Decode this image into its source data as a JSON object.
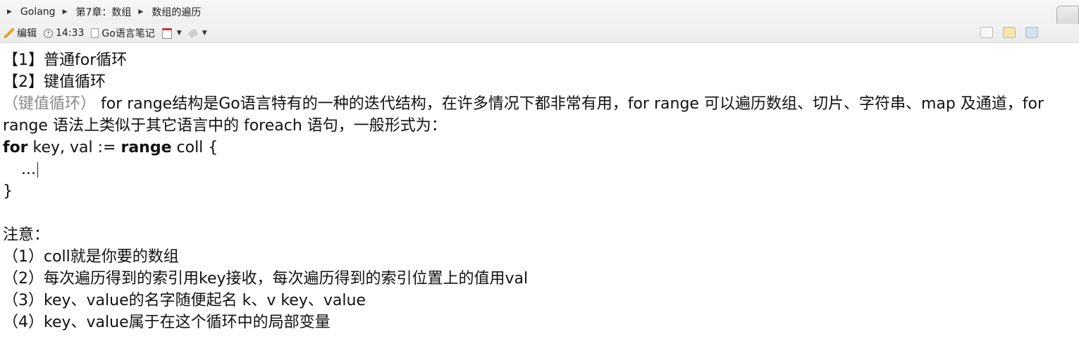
{
  "breadcrumb": [
    "Golang",
    "第7章：数组",
    "数组的遍历"
  ],
  "info": {
    "edit_label": "编辑",
    "time": "14:33",
    "notebook": "Go语言笔记"
  },
  "content": {
    "line1": "【1】普通for循环",
    "line2": "【2】键值循环",
    "intro_gray": "（键值循环）",
    "intro_text": " for range结构是Go语言特有的一种的迭代结构，在许多情况下都非常有用，for range 可以遍历数组、切片、字符串、map 及通道，for range 语法上类似于其它语言中的 foreach 语句，一般形式为：",
    "code_for": "for",
    "code_mid": " key, val := ",
    "code_range": "range",
    "code_end": " coll {",
    "code_body": "...",
    "code_close": "}",
    "note_title": "注意：",
    "notes": [
      "（1）coll就是你要的数组",
      "（2）每次遍历得到的索引用key接收，每次遍历得到的索引位置上的值用val",
      "（3）key、value的名字随便起名  k、v   key、value",
      "（4）key、value属于在这个循环中的局部变量"
    ]
  }
}
